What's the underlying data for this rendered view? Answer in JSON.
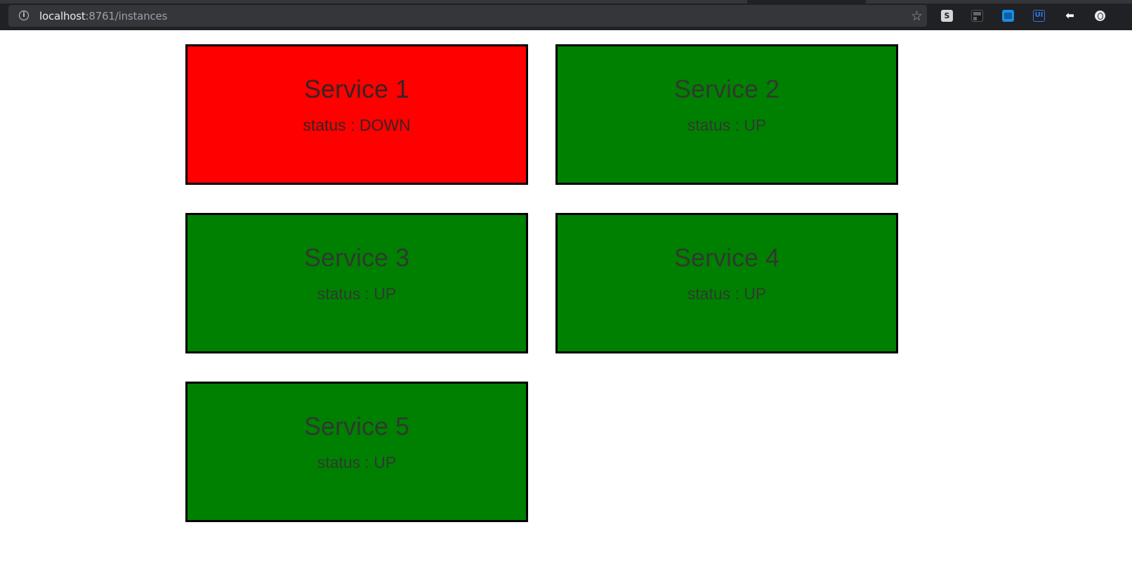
{
  "browser": {
    "url_host": "localhost",
    "url_rest": ":8761/instances",
    "extensions": [
      "s-extension-icon",
      "grid-extension-icon",
      "picture-extension-icon",
      "ui-extension-icon",
      "back-arrow-extension-icon",
      "circle-extension-icon"
    ],
    "ext_s_label": "S",
    "ext_ui_label": "UI"
  },
  "colors": {
    "up": "#008000",
    "down": "#ff0000",
    "border": "#000000"
  },
  "services": [
    {
      "name": "Service 1",
      "status_text": "status : DOWN",
      "status": "DOWN"
    },
    {
      "name": "Service 2",
      "status_text": "status : UP",
      "status": "UP"
    },
    {
      "name": "Service 3",
      "status_text": "status : UP",
      "status": "UP"
    },
    {
      "name": "Service 4",
      "status_text": "status : UP",
      "status": "UP"
    },
    {
      "name": "Service 5",
      "status_text": "status : UP",
      "status": "UP"
    }
  ]
}
